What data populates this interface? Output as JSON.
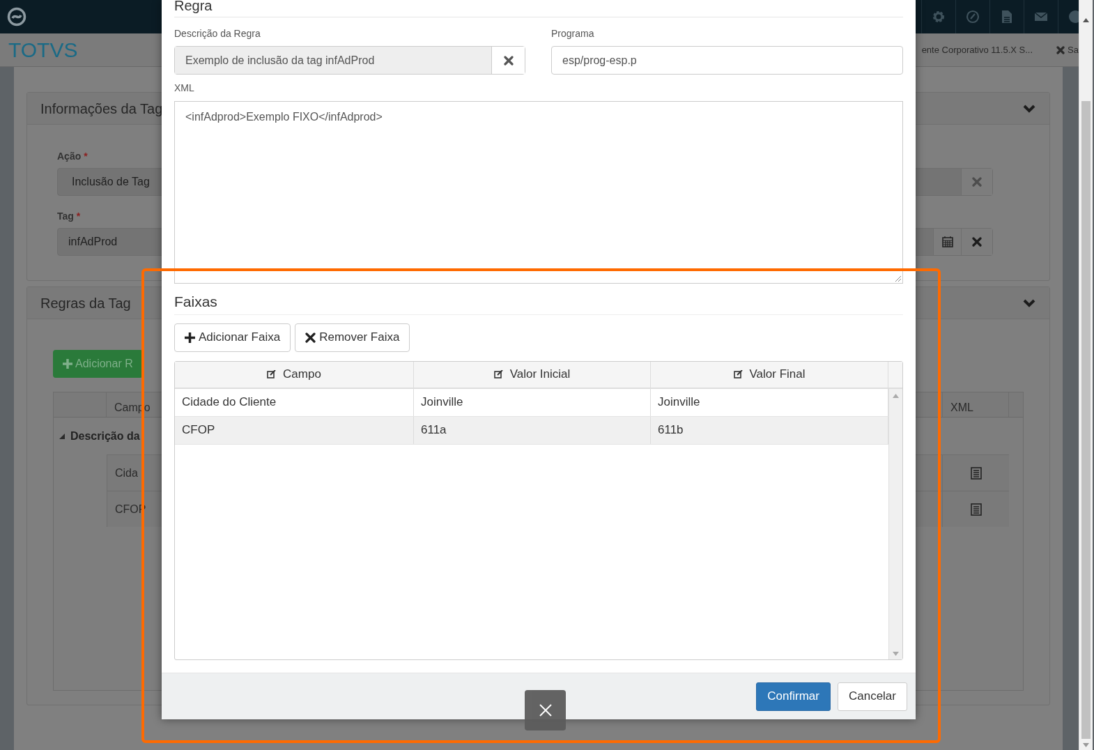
{
  "header": {
    "brand": "TOTVS",
    "tabs": [
      {
        "label": "ente Corporativo 11.5.X S...",
        "closable": false
      },
      {
        "label": "Sa",
        "closable": true
      }
    ]
  },
  "sections": [
    {
      "title": "Informações da Tag",
      "expanded": true,
      "fields": [
        {
          "label": "Ação",
          "mark": "*",
          "value": "Inclusão de Tag",
          "kind": "clearable"
        },
        {
          "label": "Tag",
          "mark": "*",
          "value": "infAdProd",
          "kind": "calendar"
        }
      ]
    },
    {
      "title": "Regras da Tag",
      "expanded": true,
      "button": "Adicionar R",
      "table": {
        "columns": [
          "Campo",
          "XML"
        ],
        "group": "Descrição da",
        "rows": [
          "Cida",
          "CFOP"
        ]
      }
    }
  ],
  "modal": {
    "title": "Regra",
    "description": {
      "label": "Descrição da Regra",
      "value": "Exemplo de inclusão da tag infAdProd"
    },
    "program": {
      "label": "Programa",
      "value": "esp/prog-esp.p"
    },
    "xml": {
      "label": "XML",
      "value": "<infAdprod>Exemplo FIXO</infAdprod>"
    },
    "ranges": {
      "title": "Faixas",
      "buttons": [
        {
          "label": "Adicionar Faixa",
          "kind": "add"
        },
        {
          "label": "Remover Faixa",
          "kind": "remove"
        }
      ],
      "columns": [
        "Campo",
        "Valor Inicial",
        "Valor Final"
      ],
      "rows": [
        {
          "cells": [
            "Cidade do Cliente",
            "Joinville",
            "Joinville"
          ]
        },
        {
          "cells": [
            "CFOP",
            "611a",
            "611b"
          ]
        }
      ]
    },
    "footer_buttons": [
      {
        "label": "Confirmar",
        "kind": "primary"
      },
      {
        "label": "Cancelar",
        "kind": "default"
      }
    ]
  }
}
